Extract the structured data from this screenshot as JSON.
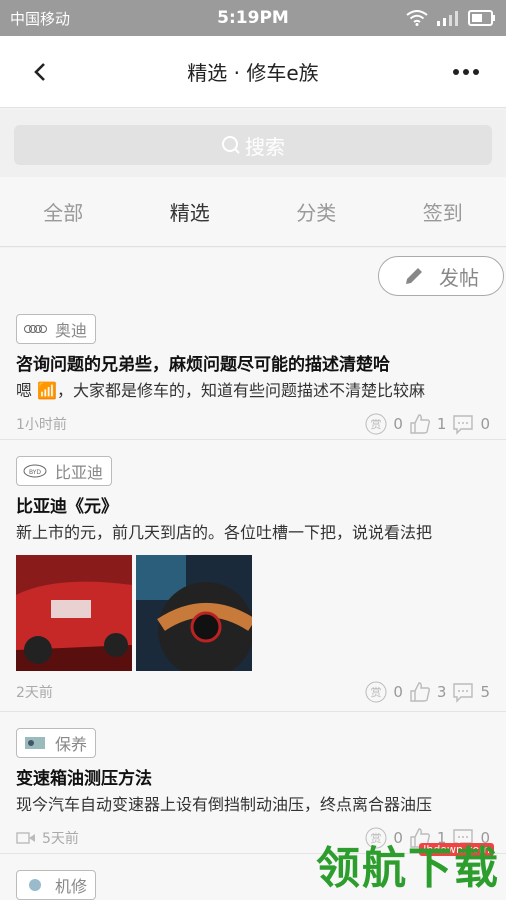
{
  "status": {
    "carrier": "中国移动",
    "time": "5:19PM"
  },
  "nav": {
    "title": "精选 · 修车e族"
  },
  "search": {
    "placeholder": "搜索"
  },
  "tabs": [
    {
      "label": "全部"
    },
    {
      "label": "精选"
    },
    {
      "label": "分类"
    },
    {
      "label": "签到"
    }
  ],
  "post_button": {
    "label": "发帖"
  },
  "posts": [
    {
      "tag": "奥迪",
      "title": "咨询问题的兄弟些，麻烦问题尽可能的描述清楚哈",
      "body": "嗯 📶，大家都是修车的，知道有些问题描述不清楚比较麻",
      "time": "1小时前",
      "reward": "0",
      "likes": "1",
      "comments": "0"
    },
    {
      "tag": "比亚迪",
      "title": "比亚迪《元》",
      "body": "新上市的元，前几天到店的。各位吐槽一下把，说说看法把",
      "time": "2天前",
      "reward": "0",
      "likes": "3",
      "comments": "5"
    },
    {
      "tag": "保养",
      "title": "变速箱油测压方法",
      "body": "现今汽车自动变速器上设有倒挡制动油压，终点离合器油压",
      "time": "5天前",
      "reward": "0",
      "likes": "1",
      "comments": "0"
    },
    {
      "tag": "机修"
    }
  ],
  "watermark": {
    "text": "领航下载",
    "url": "lhdown.com"
  },
  "icons": {
    "back": "chevron-left-icon",
    "more": "more-dots-icon",
    "search": "search-icon",
    "edit": "pencil-icon",
    "reward": "reward-icon",
    "like": "thumb-up-icon",
    "comment": "comment-icon",
    "video": "video-icon"
  },
  "colors": {
    "statusbar": "#9b9b9b",
    "watermark": "#2d9e2d"
  }
}
